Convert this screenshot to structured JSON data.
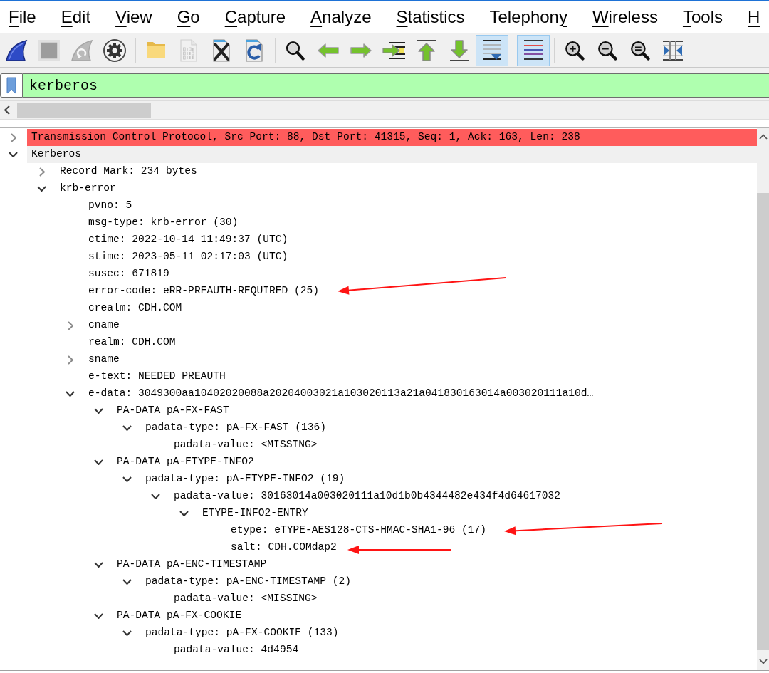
{
  "menu": [
    {
      "access_key": "F",
      "text_after": "ile"
    },
    {
      "access_key": "E",
      "text_after": "dit"
    },
    {
      "access_key": "V",
      "text_after": "iew"
    },
    {
      "access_key": "G",
      "text_after": "o"
    },
    {
      "access_key": "C",
      "text_after": "apture"
    },
    {
      "access_key": "A",
      "text_after": "nalyze"
    },
    {
      "access_key": "S",
      "text_after": "tatistics"
    },
    {
      "text_before": "Telephon",
      "access_key": "y"
    },
    {
      "access_key": "W",
      "text_after": "ireless"
    },
    {
      "access_key": "T",
      "text_after": "ools"
    },
    {
      "access_key": "H"
    }
  ],
  "toolbar": {
    "groups": [
      {
        "buttons": [
          {
            "kind": "start",
            "disabled": false
          },
          {
            "kind": "stop",
            "disabled": true
          },
          {
            "kind": "restart",
            "disabled": true
          },
          {
            "kind": "options",
            "disabled": false
          }
        ]
      },
      {
        "buttons": [
          {
            "kind": "open",
            "disabled": false
          },
          {
            "kind": "save",
            "disabled": true
          },
          {
            "kind": "close",
            "disabled": false
          },
          {
            "kind": "reload",
            "disabled": false
          }
        ]
      },
      {
        "buttons": [
          {
            "kind": "find",
            "disabled": false
          },
          {
            "kind": "back",
            "disabled": false
          },
          {
            "kind": "forward",
            "disabled": false
          },
          {
            "kind": "go_to",
            "disabled": false
          },
          {
            "kind": "first",
            "disabled": false
          },
          {
            "kind": "last",
            "disabled": false
          },
          {
            "kind": "autoscroll",
            "disabled": false,
            "on": true
          }
        ]
      },
      {
        "buttons": [
          {
            "kind": "colorize",
            "disabled": false,
            "on": true
          }
        ]
      },
      {
        "buttons": [
          {
            "kind": "zoom_in",
            "disabled": false
          },
          {
            "kind": "zoom_out",
            "disabled": false
          },
          {
            "kind": "zoom_reset",
            "disabled": false
          },
          {
            "kind": "resize_columns",
            "disabled": false
          }
        ]
      }
    ]
  },
  "filter": {
    "value": "kerberos",
    "valid": true
  },
  "details": [
    {
      "label": "Transmission Control Protocol, Src Port: 88, Dst Port: 41315, Seq: 1, Ack: 163, Len: 238",
      "expanded": false,
      "selected": false,
      "error": true
    },
    {
      "label": "Kerberos",
      "expanded": true,
      "selected": true,
      "error": false,
      "children": [
        {
          "label": "Record Mark: 234 bytes",
          "expanded": false,
          "selected": false
        },
        {
          "label": "krb-error",
          "expanded": true,
          "selected": false,
          "children": [
            {
              "label": "pvno: 5",
              "selected": false
            },
            {
              "label": "msg-type: krb-error (30)",
              "selected": false
            },
            {
              "label": "ctime: 2022-10-14 11:49:37 (UTC)",
              "selected": false
            },
            {
              "label": "stime: 2023-05-11 02:17:03 (UTC)",
              "selected": false
            },
            {
              "label": "susec: 671819",
              "selected": false
            },
            {
              "label": "error-code: eRR-PREAUTH-REQUIRED (25)",
              "selected": false
            },
            {
              "label": "crealm: CDH.COM",
              "selected": false
            },
            {
              "label": "cname",
              "expanded": false,
              "selected": false
            },
            {
              "label": "realm: CDH.COM",
              "selected": false
            },
            {
              "label": "sname",
              "expanded": false,
              "selected": false
            },
            {
              "label": "e-text: NEEDED_PREAUTH",
              "selected": false
            },
            {
              "label": "e-data: 3049300aa10402020088a20204003021a103020113a21a041830163014a003020111a10d…",
              "expanded": true,
              "selected": false,
              "children": [
                {
                  "label": "PA-DATA pA-FX-FAST",
                  "expanded": true,
                  "selected": false,
                  "children": [
                    {
                      "label": "padata-type: pA-FX-FAST (136)",
                      "expanded": true,
                      "selected": false,
                      "children": [
                        {
                          "label": "padata-value: <MISSING>",
                          "selected": false
                        }
                      ]
                    }
                  ]
                },
                {
                  "label": "PA-DATA pA-ETYPE-INFO2",
                  "expanded": true,
                  "selected": false,
                  "children": [
                    {
                      "label": "padata-type: pA-ETYPE-INFO2 (19)",
                      "expanded": true,
                      "selected": false,
                      "children": [
                        {
                          "label": "padata-value: 30163014a003020111a10d1b0b4344482e434f4d64617032",
                          "expanded": true,
                          "selected": false,
                          "children": [
                            {
                              "label": "ETYPE-INFO2-ENTRY",
                              "expanded": true,
                              "selected": false,
                              "children": [
                                {
                                  "label": "etype: eTYPE-AES128-CTS-HMAC-SHA1-96 (17)",
                                  "selected": false
                                },
                                {
                                  "label": "salt: CDH.COMdap2",
                                  "selected": false
                                }
                              ]
                            }
                          ]
                        }
                      ]
                    }
                  ]
                },
                {
                  "label": "PA-DATA pA-ENC-TIMESTAMP",
                  "expanded": true,
                  "selected": false,
                  "children": [
                    {
                      "label": "padata-type: pA-ENC-TIMESTAMP (2)",
                      "expanded": true,
                      "selected": false,
                      "children": [
                        {
                          "label": "padata-value: <MISSING>",
                          "selected": false
                        }
                      ]
                    }
                  ]
                },
                {
                  "label": "PA-DATA pA-FX-COOKIE",
                  "expanded": true,
                  "selected": false,
                  "children": [
                    {
                      "label": "padata-type: pA-FX-COOKIE (133)",
                      "expanded": true,
                      "selected": false,
                      "children": [
                        {
                          "label": "padata-value: 4d4954",
                          "selected": false
                        }
                      ]
                    }
                  ]
                }
              ]
            }
          ]
        }
      ]
    }
  ]
}
